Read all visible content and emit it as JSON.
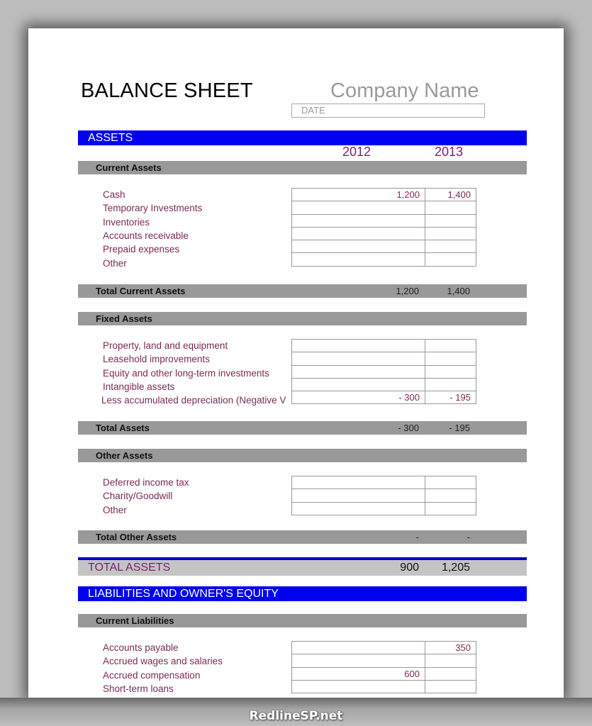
{
  "document": {
    "title": "BALANCE SHEET",
    "company_name": "Company Name",
    "date_placeholder": "DATE",
    "years": [
      "2012",
      "2013"
    ]
  },
  "assets": {
    "header": "ASSETS",
    "current": {
      "label": "Current Assets",
      "items": [
        {
          "label": "Cash",
          "y2012": "1,200",
          "y2013": "1,400"
        },
        {
          "label": "Temporary Investments",
          "y2012": "",
          "y2013": ""
        },
        {
          "label": "Inventories",
          "y2012": "",
          "y2013": ""
        },
        {
          "label": "Accounts receivable",
          "y2012": "",
          "y2013": ""
        },
        {
          "label": "Prepaid expenses",
          "y2012": "",
          "y2013": ""
        },
        {
          "label": "Other",
          "y2012": "",
          "y2013": ""
        }
      ],
      "total": {
        "label": "Total Current Assets",
        "y2012": "1,200",
        "y2013": "1,400"
      }
    },
    "fixed": {
      "label": "Fixed Assets",
      "items": [
        {
          "label": "Property, land and equipment",
          "y2012": "",
          "y2013": ""
        },
        {
          "label": "Leasehold improvements",
          "y2012": "",
          "y2013": ""
        },
        {
          "label": "Equity and other long-term investments",
          "y2012": "",
          "y2013": ""
        },
        {
          "label": "Intangible assets",
          "y2012": "",
          "y2013": ""
        },
        {
          "label": "Less accumulated depreciation (Negative V",
          "y2012": "- 300",
          "y2013": "- 195"
        }
      ],
      "total": {
        "label": "Total Assets",
        "y2012": "- 300",
        "y2013": "- 195"
      }
    },
    "other": {
      "label": "Other Assets",
      "items": [
        {
          "label": "Deferred income tax",
          "y2012": "",
          "y2013": ""
        },
        {
          "label": "Charity/Goodwill",
          "y2012": "",
          "y2013": ""
        },
        {
          "label": "Other",
          "y2012": "",
          "y2013": ""
        }
      ],
      "total": {
        "label": "Total Other Assets",
        "y2012": "-",
        "y2013": "-"
      }
    },
    "grand_total": {
      "label": "TOTAL ASSETS",
      "y2012": "900",
      "y2013": "1,205"
    }
  },
  "liabilities": {
    "header": "LIABILITIES AND OWNER'S EQUITY",
    "current": {
      "label": "Current Liabilities",
      "items": [
        {
          "label": "Accounts payable",
          "y2012": "",
          "y2013": "350"
        },
        {
          "label": "Accrued wages and salaries",
          "y2012": "",
          "y2013": ""
        },
        {
          "label": "Accrued compensation",
          "y2012": "600",
          "y2013": ""
        },
        {
          "label": "Short-term loans",
          "y2012": "",
          "y2013": ""
        }
      ]
    }
  },
  "watermark": "RedlineSP.net",
  "colors": {
    "section_blue": "#0000f0",
    "subheader_grey": "#999999",
    "label_maroon": "#7b2a55",
    "year_purple": "#7a1f6f"
  }
}
